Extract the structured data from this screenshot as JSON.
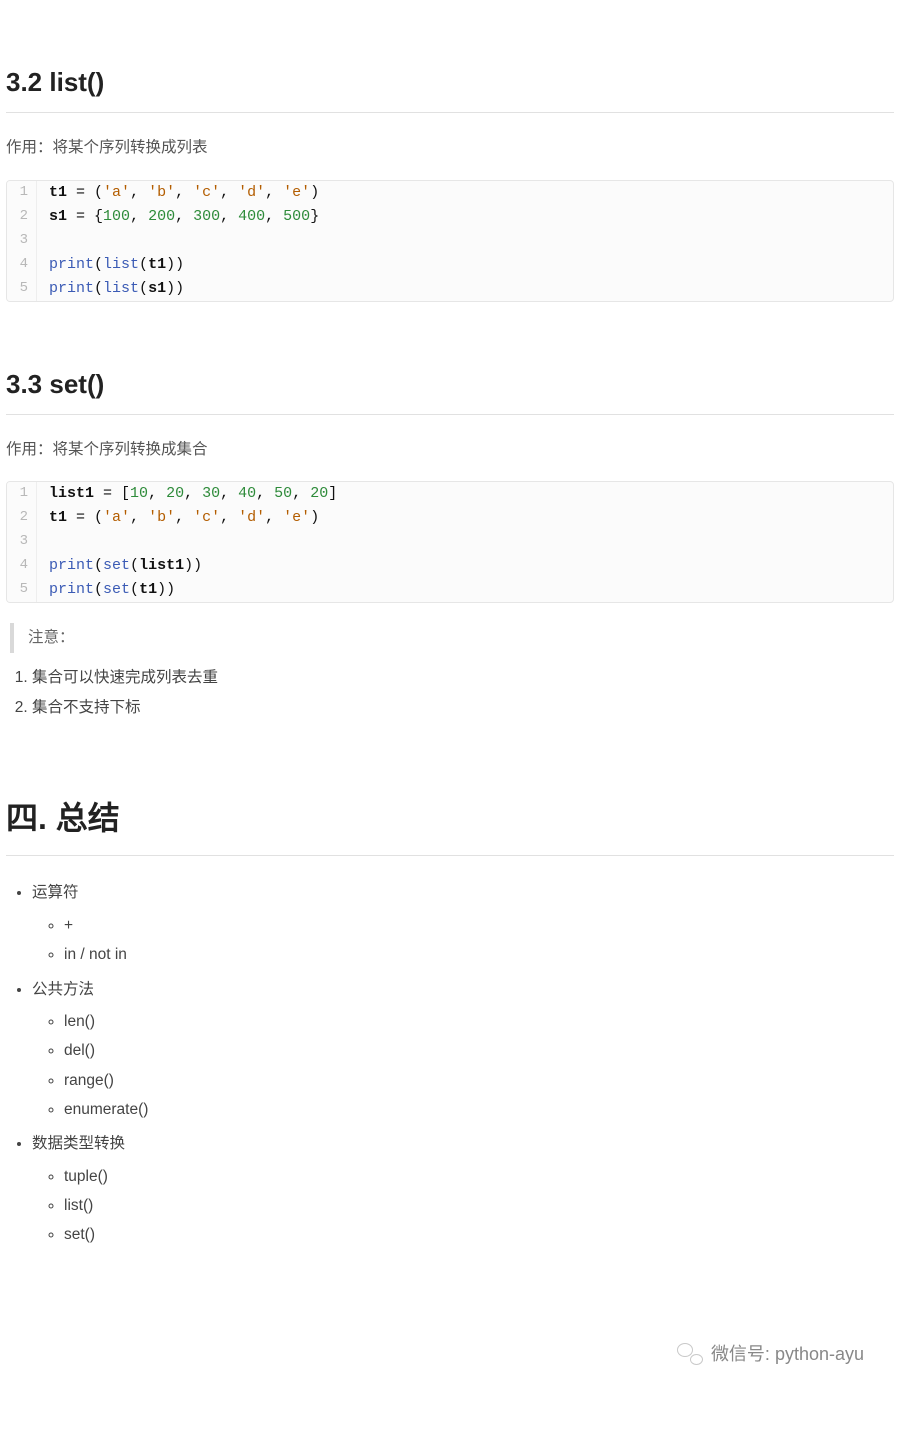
{
  "section32": {
    "heading": "3.2 list()",
    "desc": "作用：将某个序列转换成列表",
    "code": {
      "lines": [
        "1",
        "2",
        "3",
        "4",
        "5"
      ],
      "l1": {
        "v": "t1",
        "eq": " = ",
        "p1": "(",
        "s1": "'a'",
        "c1": ", ",
        "s2": "'b'",
        "c2": ", ",
        "s3": "'c'",
        "c3": ", ",
        "s4": "'d'",
        "c4": ", ",
        "s5": "'e'",
        "p2": ")"
      },
      "l2": {
        "v": "s1",
        "eq": " = ",
        "p1": "{",
        "n1": "100",
        "c1": ", ",
        "n2": "200",
        "c2": ", ",
        "n3": "300",
        "c3": ", ",
        "n4": "400",
        "c4": ", ",
        "n5": "500",
        "p2": "}"
      },
      "l4": {
        "fn": "print",
        "p1": "(",
        "fn2": "list",
        "p2": "(",
        "arg": "t1",
        "p3": "))"
      },
      "l5": {
        "fn": "print",
        "p1": "(",
        "fn2": "list",
        "p2": "(",
        "arg": "s1",
        "p3": "))"
      }
    }
  },
  "section33": {
    "heading": "3.3 set()",
    "desc": "作用：将某个序列转换成集合",
    "code": {
      "lines": [
        "1",
        "2",
        "3",
        "4",
        "5"
      ],
      "l1": {
        "v": "list1",
        "eq": " = ",
        "p1": "[",
        "n1": "10",
        "c1": ", ",
        "n2": "20",
        "c2": ", ",
        "n3": "30",
        "c3": ", ",
        "n4": "40",
        "c4": ", ",
        "n5": "50",
        "c5": ", ",
        "n6": "20",
        "p2": "]"
      },
      "l2": {
        "v": "t1",
        "eq": " = ",
        "p1": "(",
        "s1": "'a'",
        "c1": ", ",
        "s2": "'b'",
        "c2": ", ",
        "s3": "'c'",
        "c3": ", ",
        "s4": "'d'",
        "c4": ", ",
        "s5": "'e'",
        "p2": ")"
      },
      "l4": {
        "fn": "print",
        "p1": "(",
        "fn2": "set",
        "p2": "(",
        "arg": "list1",
        "p3": "))"
      },
      "l5": {
        "fn": "print",
        "p1": "(",
        "fn2": "set",
        "p2": "(",
        "arg": "t1",
        "p3": "))"
      }
    },
    "note": "注意：",
    "notes": {
      "i1": "集合可以快速完成列表去重",
      "i2": "集合不支持下标"
    }
  },
  "section4": {
    "heading": "四. 总结",
    "items": {
      "g1": {
        "label": "运算符",
        "sub": {
          "a": "+",
          "b": "in / not in"
        }
      },
      "g2": {
        "label": "公共方法",
        "sub": {
          "a": "len()",
          "b": "del()",
          "c": "range()",
          "d": "enumerate()"
        }
      },
      "g3": {
        "label": "数据类型转换",
        "sub": {
          "a": "tuple()",
          "b": "list()",
          "c": "set()"
        }
      }
    }
  },
  "footer": {
    "label": "微信号: python-ayu"
  }
}
